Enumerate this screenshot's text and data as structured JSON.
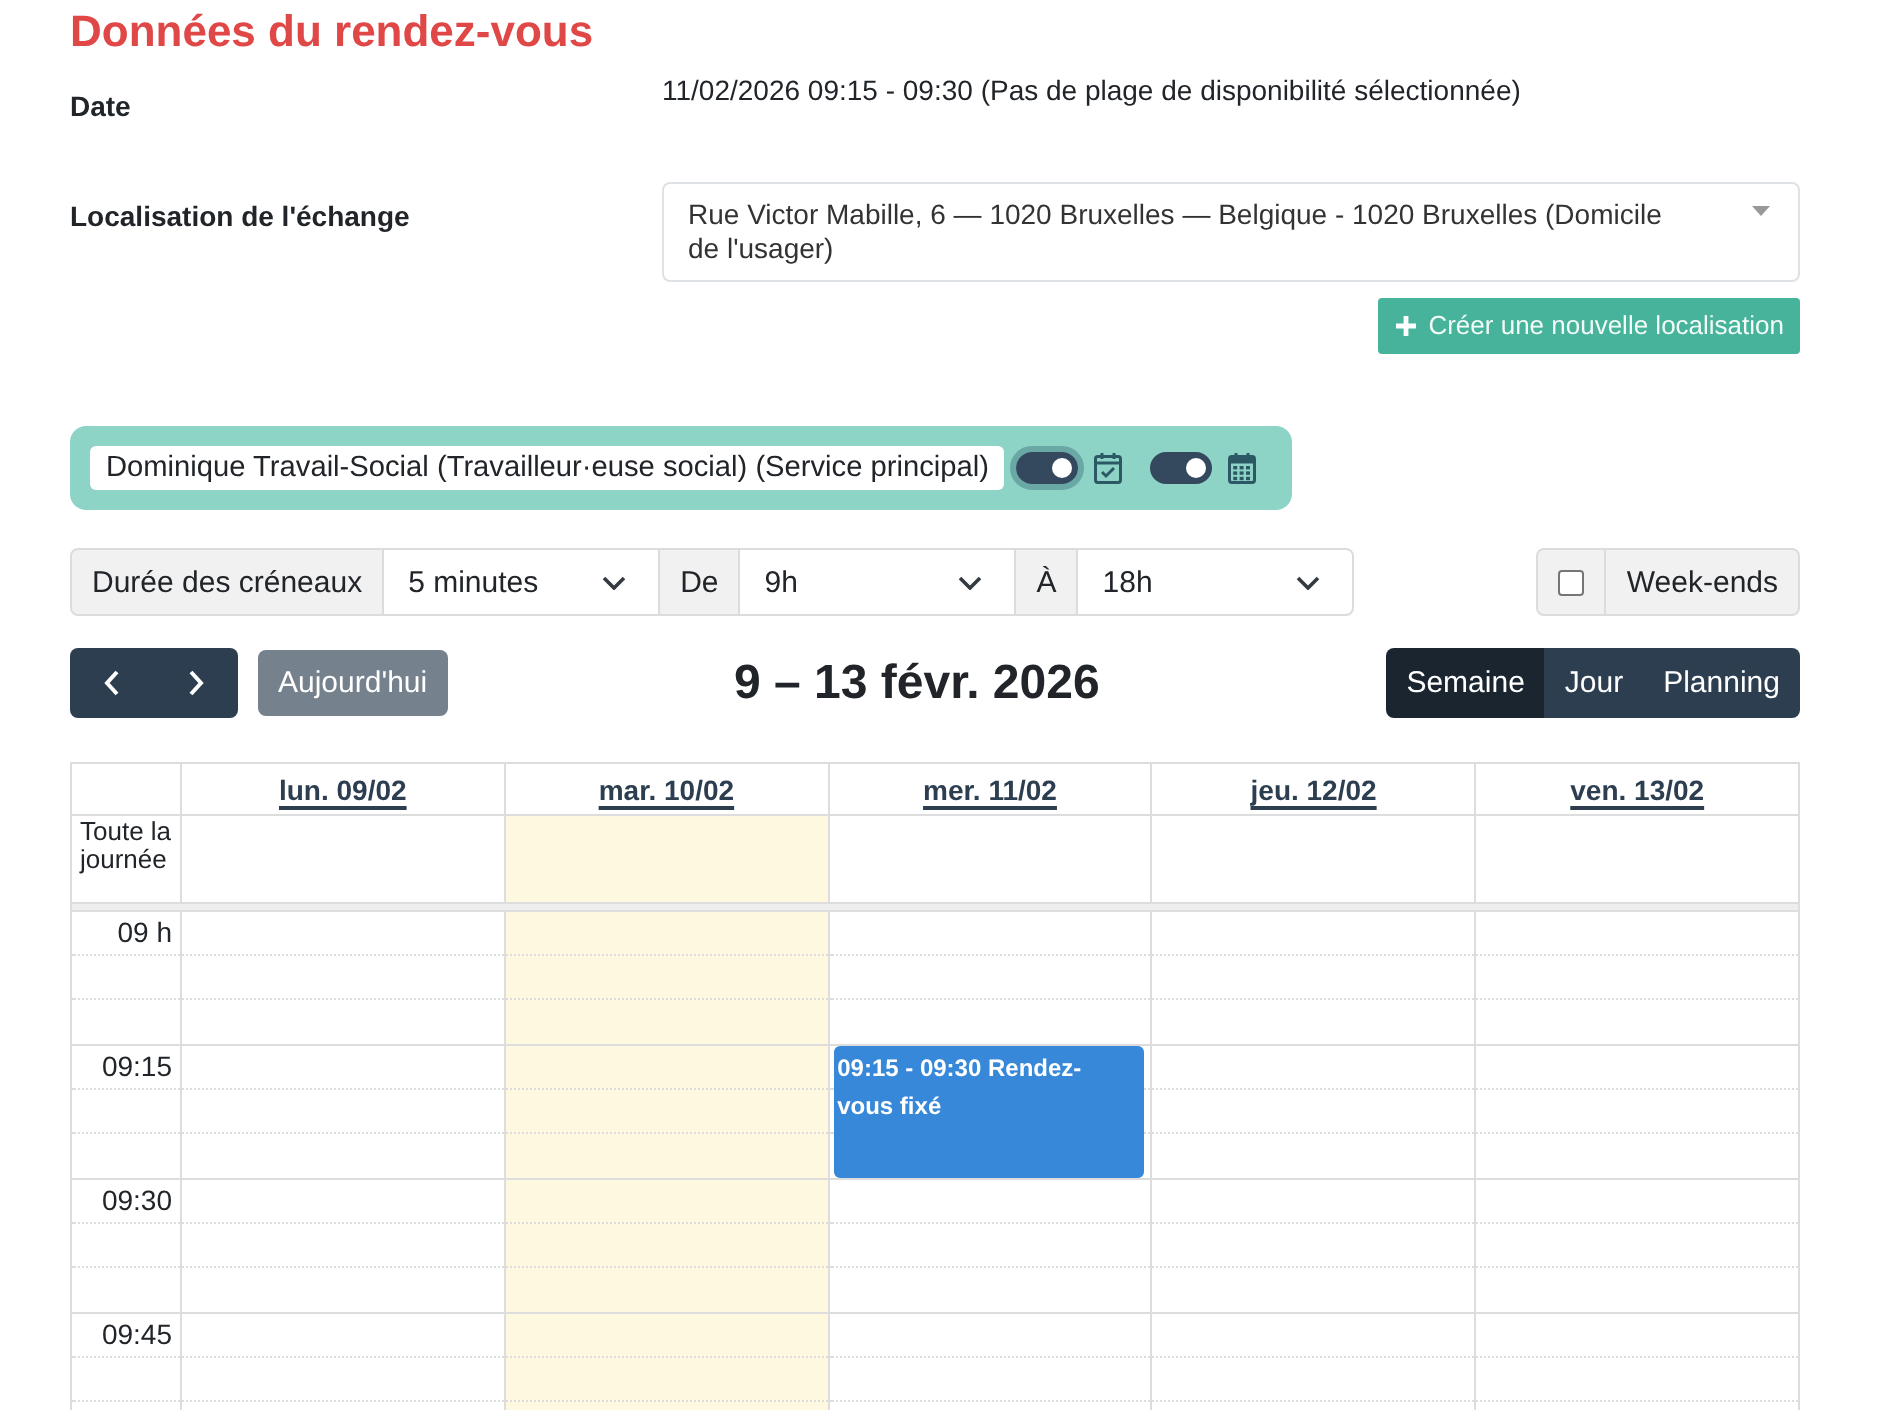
{
  "section_title": "Données du rendez-vous",
  "fields": [
    {
      "kind": "text",
      "label": "Date",
      "value": "11/02/2026 09:15 - 09:30 (Pas de plage de disponibilité sélectionnée)"
    },
    {
      "kind": "select",
      "label": "Localisation de l'échange",
      "value": "Rue Victor Mabille, 6 — 1020 Bruxelles — Belgique - 1020 Bruxelles (Domicile de l'usager)"
    }
  ],
  "create_location_button": {
    "label": "Créer une nouvelle localisation"
  },
  "agenda_panel": {
    "user": "Dominique Travail-Social (Travailleur·euse social) (Service principal)",
    "toggles": [
      {
        "on": true,
        "focused": true
      },
      {
        "on": true,
        "focused": false
      }
    ]
  },
  "slot_settings": [
    {
      "kind": "label",
      "text": "Durée des créneaux"
    },
    {
      "kind": "select",
      "value": "5 minutes"
    },
    {
      "kind": "label",
      "text": "De"
    },
    {
      "kind": "select",
      "value": "9h"
    },
    {
      "kind": "label",
      "text": "À"
    },
    {
      "kind": "select",
      "value": "18h"
    }
  ],
  "weekends": {
    "label": "Week-ends",
    "checked": false
  },
  "navigation": {
    "today_button": {
      "label": "Aujourd'hui",
      "disabled": true
    },
    "title": "9 – 13 févr. 2026",
    "views": [
      {
        "label": "Semaine",
        "selected": true
      },
      {
        "label": "Jour",
        "selected": false
      },
      {
        "label": "Planning",
        "selected": false
      }
    ]
  },
  "calendar": {
    "all_day_label": "Toute la journée",
    "days": [
      {
        "label": "lun. 09/02",
        "today": false
      },
      {
        "label": "mar. 10/02",
        "today": true
      },
      {
        "label": "mer. 11/02",
        "today": false,
        "events": [
          {
            "time": "09:15 - 09:30",
            "title": "Rendez-vous fixé"
          }
        ]
      },
      {
        "label": "jeu. 12/02",
        "today": false
      },
      {
        "label": "ven. 13/02",
        "today": false
      }
    ],
    "time_slots": [
      "09 h",
      "09:15",
      "09:30",
      "09:45"
    ]
  }
}
